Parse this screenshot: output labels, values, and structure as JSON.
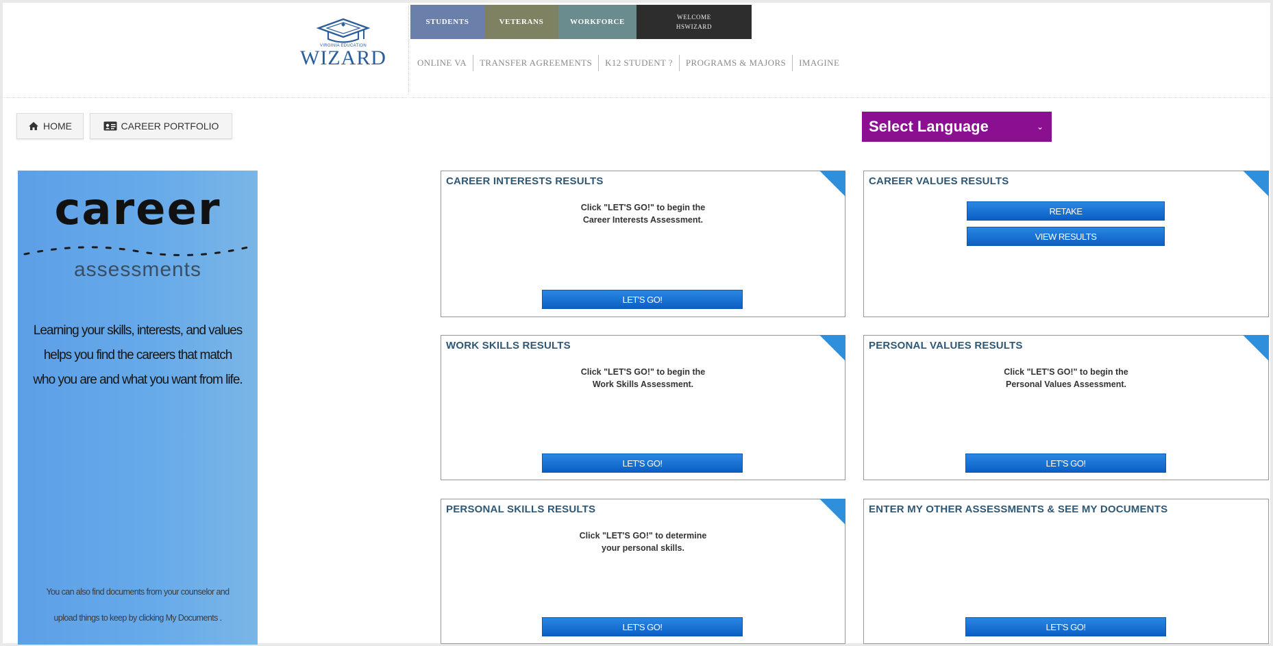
{
  "header": {
    "logo_small": "Virginia Education",
    "logo_big": "WIZARD",
    "tabs": [
      {
        "label": "STUDENTS"
      },
      {
        "label": "VETERANS"
      },
      {
        "label": "WORKFORCE"
      }
    ],
    "welcome_line1": "WELCOME",
    "welcome_line2": "HSWIZARD",
    "subnav": [
      "ONLINE VA",
      "TRANSFER AGREEMENTS",
      "K12 STUDENT ?",
      "PROGRAMS & MAJORS",
      "IMAGINE"
    ]
  },
  "toolbar": {
    "home_label": "HOME",
    "portfolio_label": "CAREER PORTFOLIO",
    "language_label": "Select Language"
  },
  "promo": {
    "title": "career",
    "subtitle": "assessments",
    "body_lines": [
      "Learning your skills, interests, and values",
      "helps you find the careers that match",
      "who you are and what you want from life."
    ],
    "foot_lines": [
      "You can also find documents from your counselor and",
      "upload things to keep by clicking My Documents ."
    ]
  },
  "cards": {
    "career_interests": {
      "title": "CAREER INTERESTS RESULTS",
      "msg1": "Click \"LET'S GO!\" to begin the",
      "msg2": "Career Interests Assessment.",
      "button": "LET'S GO!"
    },
    "career_values": {
      "title": "CAREER VALUES RESULTS",
      "retake": "RETAKE",
      "view": "VIEW RESULTS"
    },
    "work_skills": {
      "title": "WORK SKILLS RESULTS",
      "msg1": "Click \"LET'S GO!\" to begin the",
      "msg2": "Work Skills Assessment.",
      "button": "LET'S GO!"
    },
    "personal_values": {
      "title": "PERSONAL VALUES RESULTS",
      "msg1": "Click \"LET'S GO!\" to begin the",
      "msg2": "Personal Values Assessment.",
      "button": "LET'S GO!"
    },
    "personal_skills": {
      "title": "PERSONAL SKILLS RESULTS",
      "msg1": "Click \"LET'S GO!\" to determine",
      "msg2": "your personal skills.",
      "button": "LET'S GO!"
    },
    "other": {
      "title": "ENTER MY OTHER ASSESSMENTS & SEE MY DOCUMENTS",
      "button": "LET'S GO!"
    }
  },
  "colors": {
    "students_tab": "#6a7fa9",
    "veterans_tab": "#7f8163",
    "workforce_tab": "#6b8c8f",
    "welcome_tab": "#2d2d2d",
    "language_select": "#8a0f91",
    "button_blue": "#0b5fc4",
    "card_title": "#2e5776",
    "corner_accent": "#2f8fdb"
  },
  "icons": {
    "home": "home-icon",
    "portfolio": "id-card-icon",
    "language_chevron": "chevron-down-icon",
    "logo": "graduation-cap-icon"
  }
}
